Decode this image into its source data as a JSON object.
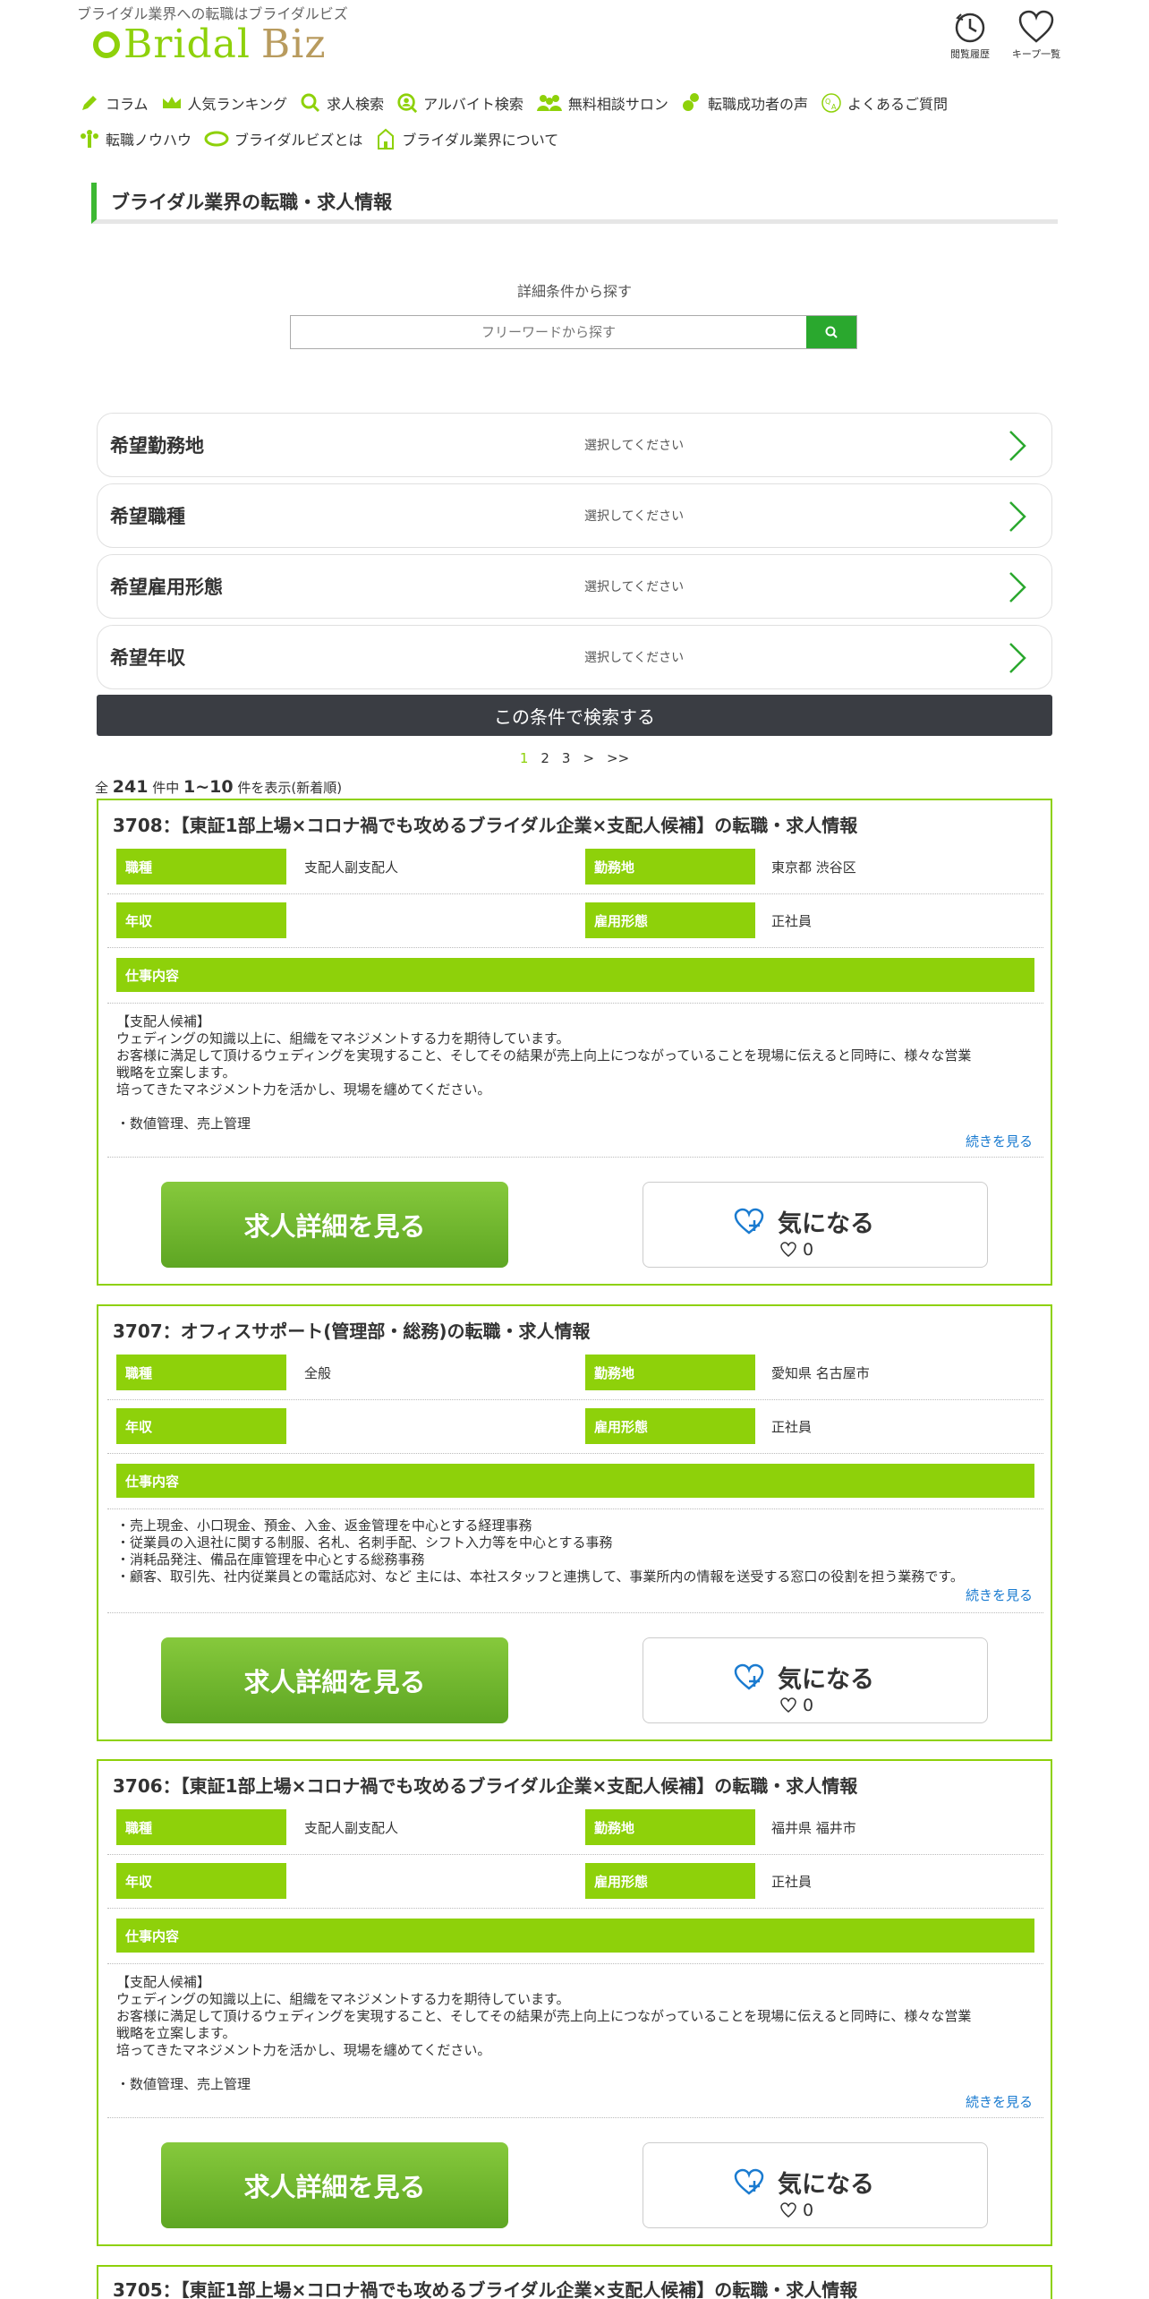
{
  "header": {
    "tagline": "ブライダル業界への転職はブライダルビズ",
    "logo_main": "Bridal",
    "logo_sub": "Biz",
    "history_label": "閲覧履歴",
    "keep_label": "キープ一覧"
  },
  "nav": {
    "row1": [
      "コラム",
      "人気ランキング",
      "求人検索",
      "アルバイト検索",
      "無料相談サロン",
      "転職成功者の声",
      "よくあるご質問"
    ],
    "row2": [
      "転職ノウハウ",
      "ブライダルビズとは",
      "ブライダル業界について"
    ]
  },
  "page_title": "ブライダル業界の転職・求人情報",
  "search": {
    "label": "詳細条件から探す",
    "placeholder": "フリーワードから探す"
  },
  "conditions": [
    {
      "label": "希望勤務地",
      "value": "選択してください"
    },
    {
      "label": "希望職種",
      "value": "選択してください"
    },
    {
      "label": "希望雇用形態",
      "value": "選択してください"
    },
    {
      "label": "希望年収",
      "value": "選択してください"
    }
  ],
  "submit_label": "この条件で検索する",
  "pager": {
    "pages": [
      "1",
      "2",
      "3",
      ">",
      ">>"
    ],
    "current": "1"
  },
  "count": {
    "prefix": "全",
    "total": "241",
    "mid": "件中",
    "range": "1~10",
    "suffix": "件を表示(新着順)"
  },
  "labels": {
    "job_type": "職種",
    "location": "勤務地",
    "salary": "年収",
    "employment": "雇用形態",
    "work": "仕事内容",
    "more": "続きを見る",
    "detail_button": "求人詳細を見る",
    "keep_button": "気になる"
  },
  "jobs": [
    {
      "title": "3708：【東証1部上場×コロナ禍でも攻めるブライダル企業×支配人候補】の転職・求人情報",
      "job_type": "支配人副支配人",
      "location": "東京都 渋谷区",
      "salary": "",
      "employment": "正社員",
      "description": "【支配人候補】\nウェディングの知識以上に、組織をマネジメントする力を期待しています。\nお客様に満足して頂けるウェディングを実現すること、そしてその結果が売上向上につながっていることを現場に伝えると同時に、様々な営業\n戦略を立案します。\n培ってきたマネジメント力を活かし、現場を纏めてください。\n\n・数値管理、売上管理",
      "keep_count": "0"
    },
    {
      "title": "3707：オフィスサポート(管理部・総務)の転職・求人情報",
      "job_type": "全般",
      "location": "愛知県 名古屋市",
      "salary": "",
      "employment": "正社員",
      "description": "・売上現金、小口現金、預金、入金、返金管理を中心とする経理事務\n・従業員の入退社に関する制服、名札、名刺手配、シフト入力等を中心とする事務\n・消耗品発注、備品在庫管理を中心とする総務事務\n・顧客、取引先、社内従業員との電話応対、など 主には、本社スタッフと連携して、事業所内の情報を送受する窓口の役割を担う業務です。",
      "keep_count": "0"
    },
    {
      "title": "3706：【東証1部上場×コロナ禍でも攻めるブライダル企業×支配人候補】の転職・求人情報",
      "job_type": "支配人副支配人",
      "location": "福井県 福井市",
      "salary": "",
      "employment": "正社員",
      "description": "【支配人候補】\nウェディングの知識以上に、組織をマネジメントする力を期待しています。\nお客様に満足して頂けるウェディングを実現すること、そしてその結果が売上向上につながっていることを現場に伝えると同時に、様々な営業\n戦略を立案します。\n培ってきたマネジメント力を活かし、現場を纏めてください。\n\n・数値管理、売上管理",
      "keep_count": "0"
    },
    {
      "title": "3705：【東証1部上場×コロナ禍でも攻めるブライダル企業×支配人候補】の転職・求人情報"
    }
  ],
  "colors": {
    "accent": "#8ed10a",
    "dark_button": "#3a3d43",
    "link": "#1a7bd0"
  }
}
